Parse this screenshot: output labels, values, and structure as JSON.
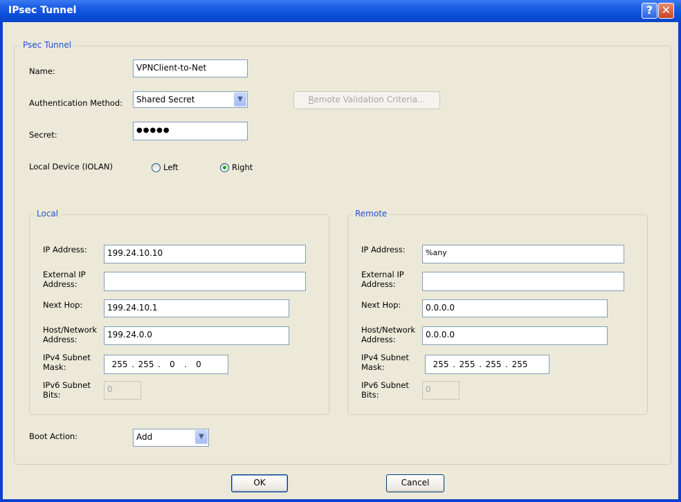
{
  "window": {
    "title": "IPsec Tunnel",
    "help_glyph": "?",
    "close_glyph": "✕"
  },
  "tunnel_group": {
    "legend": "Psec Tunnel",
    "name_label": "Name:",
    "name_value": "VPNClient-to-Net",
    "auth_label": "Authentication Method:",
    "auth_value": "Shared Secret",
    "remote_validation_label": "Remote Validation Criteria...",
    "remote_validation_accel": "R",
    "remote_validation_rest": "emote Validation Criteria...",
    "secret_label": "Secret:",
    "secret_value": "●●●●●",
    "local_device_label": "Local Device (IOLAN)",
    "radio_left": "Left",
    "radio_right": "Right",
    "selected_side": "Right"
  },
  "local": {
    "legend": "Local",
    "ip_label": "IP Address:",
    "ip_value": "199.24.10.10",
    "ext_ip_label_1": "External IP",
    "ext_ip_label_2": "Address:",
    "ext_ip_value": "",
    "next_hop_label": "Next Hop:",
    "next_hop_value": "199.24.10.1",
    "host_label_1": "Host/Network",
    "host_label_2": "Address:",
    "host_value": "199.24.0.0",
    "mask_label_1": "IPv4 Subnet",
    "mask_label_2": "Mask:",
    "mask_octets": [
      "255",
      "255",
      "0",
      "0"
    ],
    "v6_label_1": "IPv6 Subnet",
    "v6_label_2": "Bits:",
    "v6_value": "0"
  },
  "remote": {
    "legend": "Remote",
    "ip_label": "IP Address:",
    "ip_value": "%any",
    "ext_ip_label_1": "External IP",
    "ext_ip_label_2": "Address:",
    "ext_ip_value": "",
    "next_hop_label": "Next Hop:",
    "next_hop_value": "0.0.0.0",
    "host_label_1": "Host/Network",
    "host_label_2": "Address:",
    "host_value": "0.0.0.0",
    "mask_label_1": "IPv4 Subnet",
    "mask_label_2": "Mask:",
    "mask_octets": [
      "255",
      "255",
      "255",
      "255"
    ],
    "v6_label_1": "IPv6 Subnet",
    "v6_label_2": "Bits:",
    "v6_value": "0"
  },
  "boot": {
    "label": "Boot Action:",
    "value": "Add"
  },
  "buttons": {
    "ok": "OK",
    "cancel": "Cancel"
  },
  "icons": {
    "dropdown": "chevron-down-icon"
  },
  "colors": {
    "titlebar": "#0a4ed8",
    "dialog_bg": "#ece9d8",
    "legend_text": "#1f4fd6"
  }
}
